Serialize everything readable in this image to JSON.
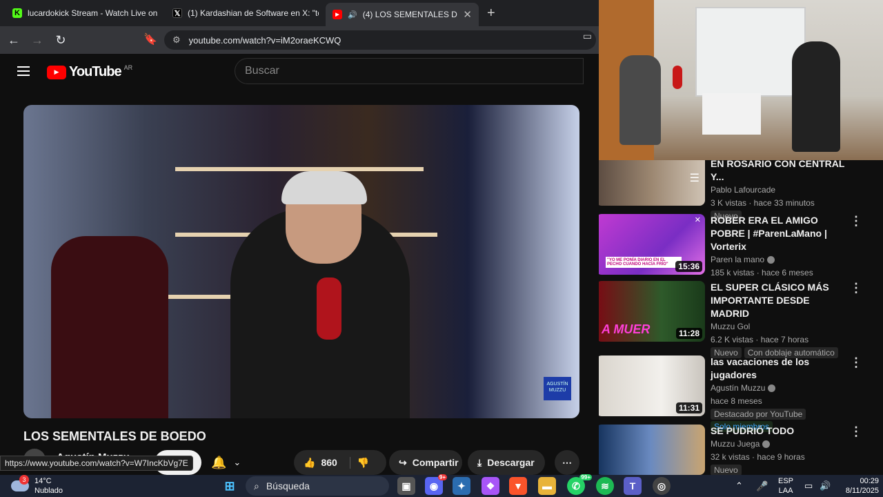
{
  "browser": {
    "tabs": [
      {
        "title": "lucardokick Stream - Watch Live on K",
        "icon": "kick-icon",
        "color": "#53fc18"
      },
      {
        "title": "(1) Kardashian de Software en X: \"tod",
        "icon": "x-icon",
        "color": "#000000"
      },
      {
        "title": "(4) LOS SEMENTALES DE BOED",
        "icon": "youtube-icon",
        "color": "#ff0000"
      }
    ],
    "url": "youtube.com/watch?v=iM2oraeKCWQ",
    "status_url": "https://www.youtube.com/watch?v=W7IncKbVg7E"
  },
  "youtube": {
    "logo_text": "YouTube",
    "country": "AR",
    "search_placeholder": "Buscar",
    "video_title": "LOS SEMENTALES DE BOEDO",
    "channel": "Agustín Muzzu",
    "subscribe_label": "se",
    "likes": "860",
    "share_label": "Compartir",
    "download_label": "Descargar",
    "video_watermark": "AGUSTÍN MUZZU"
  },
  "sidebar": [
    {
      "title": "EN ROSARIO CON CENTRAL Y...",
      "channel": "Pablo Lafourcade",
      "meta": "3 K vistas · hace 33 minutos",
      "badges": [
        "Nuevo"
      ],
      "duration": ""
    },
    {
      "title": "ROBER ERA EL AMIGO POBRE | #ParenLaMano | Vorterix",
      "channel": "Paren la mano",
      "meta": "185 k vistas · hace 6 meses",
      "badges": [],
      "duration": "15:36",
      "thumb_text": "\"YO ME PONÍA DIARIO EN EL PECHO CUANDO HACÍA FRÍO\""
    },
    {
      "title": "EL SUPER CLÁSICO MÁS IMPORTANTE DESDE MADRID",
      "channel": "Muzzu Gol",
      "meta": "6.2 K vistas · hace 7 horas",
      "badges": [
        "Nuevo",
        "Con doblaje automático"
      ],
      "duration": "11:28",
      "thumb_text": "A MUER"
    },
    {
      "title": "las vacaciones de los jugadores",
      "channel": "Agustín Muzzu",
      "meta": "hace 8 meses",
      "badges": [
        "Destacado por YouTube",
        "Solo miembros"
      ],
      "duration": "11:31"
    },
    {
      "title": "SE PUDRIÓ TODO",
      "channel": "Muzzu Juega",
      "meta": "32 k vistas · hace 9 horas",
      "badges": [
        "Nuevo"
      ],
      "duration": ""
    }
  ],
  "taskbar": {
    "temp": "14°C",
    "weather": "Nublado",
    "weather_badge": "3",
    "search_label": "Búsqueda",
    "discord_badge": "9+",
    "whatsapp_badge": "99+",
    "lang1": "ESP",
    "lang2": "LAA",
    "time": "00:29",
    "date": "8/11/2025"
  }
}
